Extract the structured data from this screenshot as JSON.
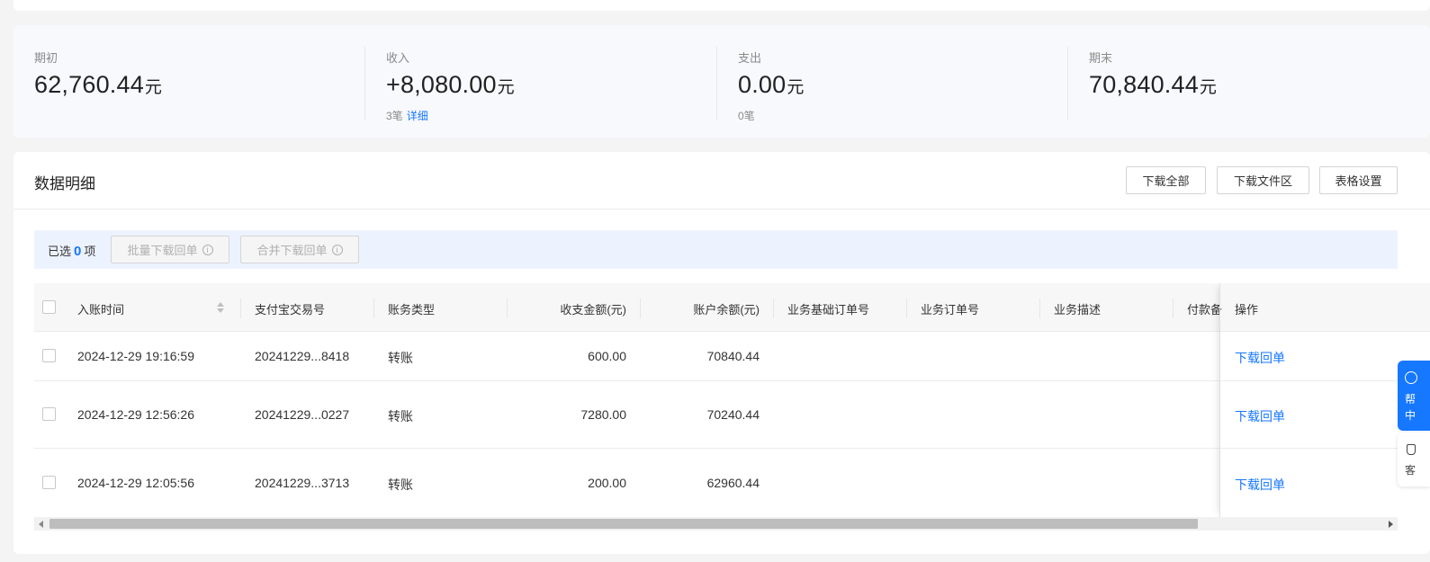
{
  "summary": {
    "opening": {
      "label": "期初",
      "amount": "62,760.44",
      "unit": "元"
    },
    "income": {
      "label": "收入",
      "amount": "+8,080.00",
      "unit": "元",
      "count": "3笔",
      "detail_link": "详细"
    },
    "expense": {
      "label": "支出",
      "amount": "0.00",
      "unit": "元",
      "count": "0笔"
    },
    "closing": {
      "label": "期末",
      "amount": "70,840.44",
      "unit": "元"
    }
  },
  "detail": {
    "title": "数据明细",
    "buttons": {
      "download_all": "下载全部",
      "download_area": "下载文件区",
      "table_settings": "表格设置"
    }
  },
  "selection": {
    "prefix": "已选",
    "count": "0",
    "suffix": "项",
    "batch_download": "批量下载回单",
    "merge_download": "合并下载回单",
    "info_glyph": "i"
  },
  "table": {
    "columns": {
      "time": "入账时间",
      "trade_no": "支付宝交易号",
      "type": "账务类型",
      "amount": "收支金额(元)",
      "balance": "账户余额(元)",
      "base_order": "业务基础订单号",
      "order": "业务订单号",
      "desc": "业务描述",
      "remark": "付款备",
      "action": "操作"
    },
    "rows": [
      {
        "time": "2024-12-29 19:16:59",
        "trade_no": "20241229...8418",
        "type": "转账",
        "amount": "600.00",
        "balance": "70840.44",
        "action": "下载回单"
      },
      {
        "time": "2024-12-29 12:56:26",
        "trade_no": "20241229...0227",
        "type": "转账",
        "amount": "7280.00",
        "balance": "70240.44",
        "action": "下载回单"
      },
      {
        "time": "2024-12-29 12:05:56",
        "trade_no": "20241229...3713",
        "type": "转账",
        "amount": "200.00",
        "balance": "62960.44",
        "action": "下载回单"
      }
    ]
  },
  "floating": {
    "help_line1": "帮",
    "help_line2": "中",
    "service_line1": "客"
  },
  "colors": {
    "accent": "#1677ff",
    "page_bg": "#f4f4f5",
    "selection_bar": "#edf3fe"
  }
}
